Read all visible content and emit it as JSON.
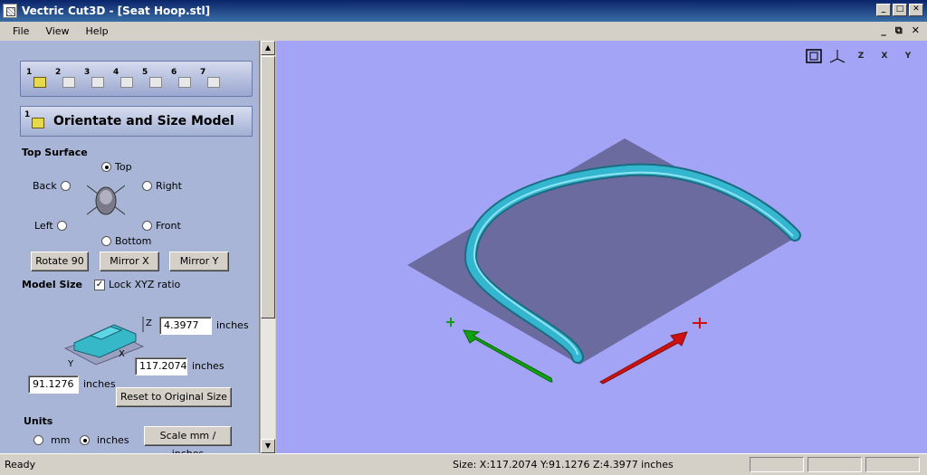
{
  "window": {
    "title": "Vectric Cut3D - [Seat Hoop.stl]"
  },
  "menu": {
    "items": [
      "File",
      "View",
      "Help"
    ]
  },
  "steps": [
    "1",
    "2",
    "3",
    "4",
    "5",
    "6",
    "7"
  ],
  "stage": {
    "number": "1",
    "title": "Orientate and Size Model"
  },
  "top_surface": {
    "label": "Top Surface",
    "options": {
      "top": "Top",
      "back": "Back",
      "right": "Right",
      "left": "Left",
      "front": "Front",
      "bottom": "Bottom"
    },
    "selected": "Top"
  },
  "buttons": {
    "rotate": "Rotate 90",
    "mirror_x": "Mirror X",
    "mirror_y": "Mirror Y",
    "reset": "Reset to Original Size",
    "scale": "Scale mm / inches"
  },
  "model_size": {
    "label": "Model Size",
    "lock_label": "Lock XYZ ratio",
    "lock_checked": true,
    "z_value": "4.3977",
    "x_value": "117.2074",
    "y_value": "91.1276",
    "unit": "inches",
    "axis_z": "Z",
    "axis_x": "X",
    "axis_y": "Y"
  },
  "units": {
    "label": "Units",
    "mm": "mm",
    "inches": "inches",
    "selected": "inches"
  },
  "view_toolbar": {
    "icons": [
      "zoom-extents-icon",
      "iso-view-icon",
      "view-z-icon",
      "view-x-icon",
      "view-y-icon"
    ],
    "labels": {
      "z": "Z",
      "x": "X",
      "y": "Y"
    }
  },
  "status": {
    "ready": "Ready",
    "size": "Size: X:117.2074 Y:91.1276 Z:4.3977 inches"
  },
  "colors": {
    "viewport_bg": "#a4a4f6",
    "plane": "#6b6ba0",
    "hoop": "#35b6d0",
    "x_axis": "#d01010",
    "y_axis": "#10a010"
  }
}
